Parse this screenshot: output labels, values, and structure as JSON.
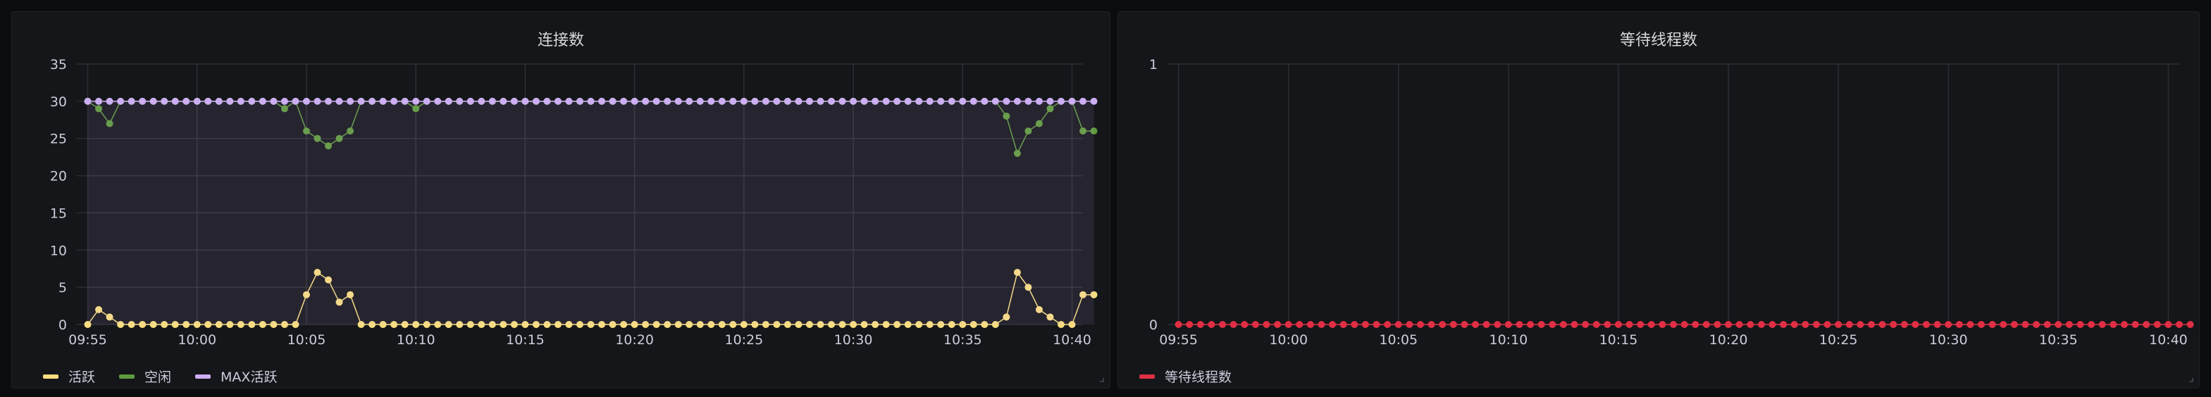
{
  "panels": {
    "connections": {
      "title": "连接数",
      "legend": [
        {
          "label": "活跃",
          "color": "#fade7e"
        },
        {
          "label": "空闲",
          "color": "#5f9b3c"
        },
        {
          "label": "MAX活跃",
          "color": "#ccaef2"
        }
      ]
    },
    "waiting": {
      "title": "等待线程数",
      "legend": [
        {
          "label": "等待线程数",
          "color": "#e02f44"
        }
      ]
    }
  },
  "chart_data": [
    {
      "type": "line",
      "title": "连接数",
      "xlabel": "",
      "ylabel": "",
      "x_ticks": [
        "09:55",
        "10:00",
        "10:05",
        "10:10",
        "10:15",
        "10:20",
        "10:25",
        "10:30",
        "10:35",
        "10:40"
      ],
      "x_range": [
        "09:54:30",
        "10:40:30"
      ],
      "y_ticks": [
        0,
        5,
        10,
        15,
        20,
        25,
        30,
        35
      ],
      "ylim": [
        0,
        35
      ],
      "grid": true,
      "legend_position": "bottom-left",
      "point_interval_seconds": 30,
      "x_start": "09:55",
      "series": [
        {
          "name": "活跃",
          "color": "#fade7e",
          "fill": false,
          "values": [
            0,
            2,
            1,
            0,
            0,
            0,
            0,
            0,
            0,
            0,
            0,
            0,
            0,
            0,
            0,
            0,
            0,
            0,
            0,
            0,
            4,
            7,
            6,
            3,
            4,
            0,
            0,
            0,
            0,
            0,
            0,
            0,
            0,
            0,
            0,
            0,
            0,
            0,
            0,
            0,
            0,
            0,
            0,
            0,
            0,
            0,
            0,
            0,
            0,
            0,
            0,
            0,
            0,
            0,
            0,
            0,
            0,
            0,
            0,
            0,
            0,
            0,
            0,
            0,
            0,
            0,
            0,
            0,
            0,
            0,
            0,
            0,
            0,
            0,
            0,
            0,
            0,
            0,
            0,
            0,
            0,
            0,
            0,
            0,
            1,
            7,
            5,
            2,
            1,
            0,
            0,
            4,
            4
          ]
        },
        {
          "name": "空闲",
          "color": "#5f9b3c",
          "fill": false,
          "values": [
            30,
            29,
            27,
            30,
            30,
            30,
            30,
            30,
            30,
            30,
            30,
            30,
            30,
            30,
            30,
            30,
            30,
            30,
            29,
            30,
            26,
            25,
            24,
            25,
            26,
            30,
            30,
            30,
            30,
            30,
            29,
            30,
            30,
            30,
            30,
            30,
            30,
            30,
            30,
            30,
            30,
            30,
            30,
            30,
            30,
            30,
            30,
            30,
            30,
            30,
            30,
            30,
            30,
            30,
            30,
            30,
            30,
            30,
            30,
            30,
            30,
            30,
            30,
            30,
            30,
            30,
            30,
            30,
            30,
            30,
            30,
            30,
            30,
            30,
            30,
            30,
            30,
            30,
            30,
            30,
            30,
            30,
            30,
            30,
            28,
            23,
            26,
            27,
            29,
            30,
            30,
            26,
            26
          ]
        },
        {
          "name": "MAX活跃",
          "color": "#ccaef2",
          "fill": true,
          "values": [
            30,
            30,
            30,
            30,
            30,
            30,
            30,
            30,
            30,
            30,
            30,
            30,
            30,
            30,
            30,
            30,
            30,
            30,
            30,
            30,
            30,
            30,
            30,
            30,
            30,
            30,
            30,
            30,
            30,
            30,
            30,
            30,
            30,
            30,
            30,
            30,
            30,
            30,
            30,
            30,
            30,
            30,
            30,
            30,
            30,
            30,
            30,
            30,
            30,
            30,
            30,
            30,
            30,
            30,
            30,
            30,
            30,
            30,
            30,
            30,
            30,
            30,
            30,
            30,
            30,
            30,
            30,
            30,
            30,
            30,
            30,
            30,
            30,
            30,
            30,
            30,
            30,
            30,
            30,
            30,
            30,
            30,
            30,
            30,
            30,
            30,
            30,
            30,
            30,
            30,
            30,
            30,
            30
          ]
        }
      ]
    },
    {
      "type": "line",
      "title": "等待线程数",
      "xlabel": "",
      "ylabel": "",
      "x_ticks": [
        "09:55",
        "10:00",
        "10:05",
        "10:10",
        "10:15",
        "10:20",
        "10:25",
        "10:30",
        "10:35",
        "10:40"
      ],
      "x_range": [
        "09:54:30",
        "10:40:30"
      ],
      "y_ticks": [
        0,
        1
      ],
      "ylim": [
        0,
        1
      ],
      "grid": true,
      "legend_position": "bottom-left",
      "point_interval_seconds": 30,
      "x_start": "09:55",
      "series": [
        {
          "name": "等待线程数",
          "color": "#e02f44",
          "fill": false,
          "values": [
            0,
            0,
            0,
            0,
            0,
            0,
            0,
            0,
            0,
            0,
            0,
            0,
            0,
            0,
            0,
            0,
            0,
            0,
            0,
            0,
            0,
            0,
            0,
            0,
            0,
            0,
            0,
            0,
            0,
            0,
            0,
            0,
            0,
            0,
            0,
            0,
            0,
            0,
            0,
            0,
            0,
            0,
            0,
            0,
            0,
            0,
            0,
            0,
            0,
            0,
            0,
            0,
            0,
            0,
            0,
            0,
            0,
            0,
            0,
            0,
            0,
            0,
            0,
            0,
            0,
            0,
            0,
            0,
            0,
            0,
            0,
            0,
            0,
            0,
            0,
            0,
            0,
            0,
            0,
            0,
            0,
            0,
            0,
            0,
            0,
            0,
            0,
            0,
            0,
            0,
            0,
            0,
            0
          ]
        }
      ]
    }
  ]
}
